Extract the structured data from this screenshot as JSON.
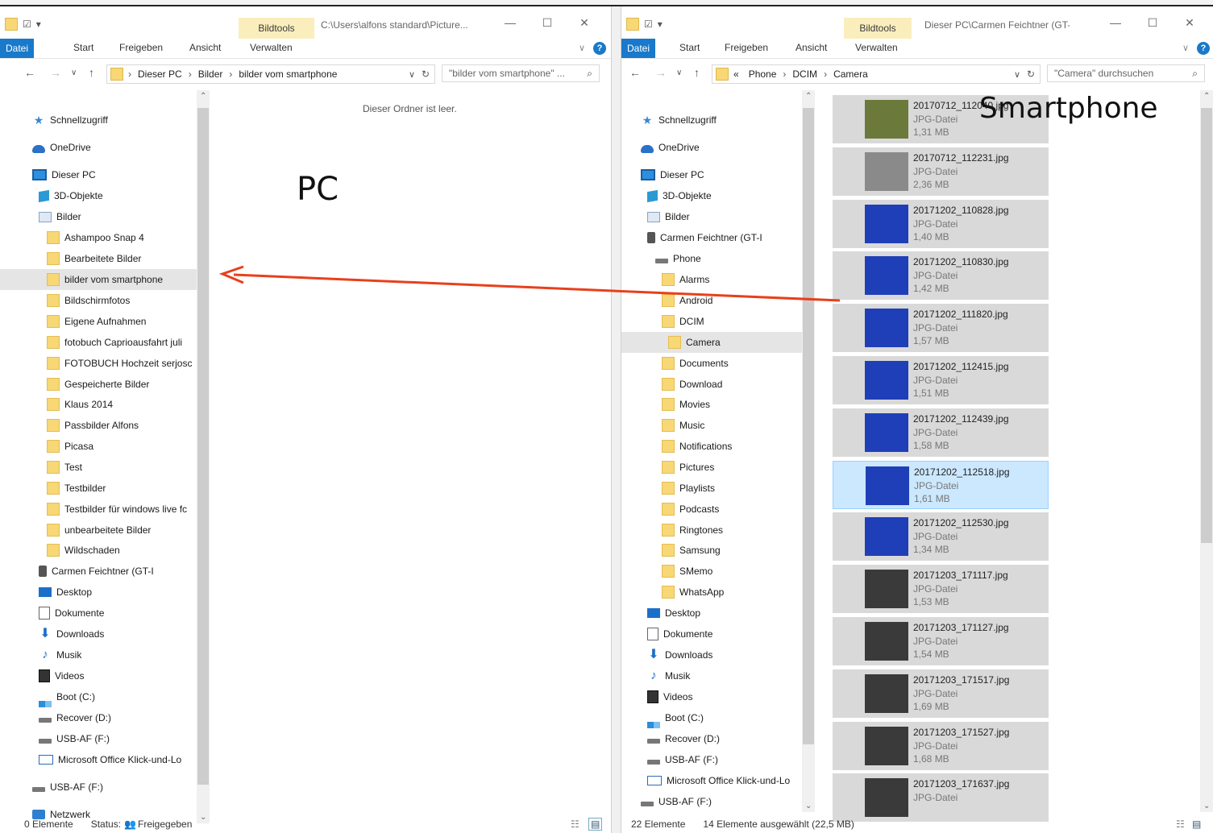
{
  "left_window": {
    "path_title": "C:\\Users\\alfons standard\\Picture...",
    "context_tab": "Bildtools",
    "ribbon_tabs": [
      "Datei",
      "Start",
      "Freigeben",
      "Ansicht",
      "Verwalten"
    ],
    "breadcrumb": [
      "Dieser PC",
      "Bilder",
      "bilder vom smartphone"
    ],
    "search_placeholder": "\"bilder vom smartphone\" ...",
    "empty_message": "Dieser Ordner ist leer.",
    "overlay_label": "PC",
    "nav": [
      {
        "label": "Schnellzugriff",
        "icon": "star-icon"
      },
      {
        "label": "OneDrive",
        "icon": "cloud-icon"
      },
      {
        "label": "Dieser PC",
        "icon": "pc-icon"
      },
      {
        "label": "3D-Objekte",
        "icon": "cube-icon"
      },
      {
        "label": "Bilder",
        "icon": "pictures-icon"
      },
      {
        "label": "Ashampoo Snap 4",
        "icon": "folder-icon"
      },
      {
        "label": "Bearbeitete Bilder",
        "icon": "folder-icon"
      },
      {
        "label": "bilder vom smartphone",
        "icon": "folder-icon",
        "selected": true
      },
      {
        "label": "Bildschirmfotos",
        "icon": "folder-icon"
      },
      {
        "label": "Eigene Aufnahmen",
        "icon": "folder-icon"
      },
      {
        "label": "fotobuch Caprioausfahrt juli",
        "icon": "folder-icon"
      },
      {
        "label": "FOTOBUCH Hochzeit serjosc",
        "icon": "folder-icon"
      },
      {
        "label": "Gespeicherte Bilder",
        "icon": "folder-icon"
      },
      {
        "label": "Klaus 2014",
        "icon": "folder-icon"
      },
      {
        "label": "Passbilder Alfons",
        "icon": "folder-icon"
      },
      {
        "label": "Picasa",
        "icon": "folder-icon"
      },
      {
        "label": "Test",
        "icon": "folder-icon"
      },
      {
        "label": "Testbilder",
        "icon": "folder-icon"
      },
      {
        "label": "Testbilder für windows live fc",
        "icon": "folder-icon"
      },
      {
        "label": "unbearbeitete Bilder",
        "icon": "folder-icon"
      },
      {
        "label": "Wildschaden",
        "icon": "folder-icon"
      },
      {
        "label": "Carmen Feichtner (GT-I",
        "icon": "phone-icon"
      },
      {
        "label": "Desktop",
        "icon": "desktop-icon"
      },
      {
        "label": "Dokumente",
        "icon": "document-icon"
      },
      {
        "label": "Downloads",
        "icon": "download-icon"
      },
      {
        "label": "Musik",
        "icon": "music-icon"
      },
      {
        "label": "Videos",
        "icon": "video-icon"
      },
      {
        "label": "Boot (C:)",
        "icon": "windows-drive-icon"
      },
      {
        "label": "Recover (D:)",
        "icon": "drive-icon"
      },
      {
        "label": "USB-AF (F:)",
        "icon": "drive-icon"
      },
      {
        "label": "Microsoft Office Klick-und-Lo",
        "icon": "office-icon"
      },
      {
        "label": "USB-AF (F:)",
        "icon": "drive-icon"
      },
      {
        "label": "Netzwerk",
        "icon": "network-icon"
      }
    ],
    "status_count": "0 Elemente",
    "status_share": "Status:",
    "status_share_value": "Freigegeben"
  },
  "right_window": {
    "path_title": "Dieser PC\\Carmen Feichtner (GT-...",
    "context_tab": "Bildtools",
    "ribbon_tabs": [
      "Datei",
      "Start",
      "Freigeben",
      "Ansicht",
      "Verwalten"
    ],
    "breadcrumb": [
      "«",
      "Phone",
      "DCIM",
      "Camera"
    ],
    "search_placeholder": "\"Camera\" durchsuchen",
    "overlay_label": "Smartphone",
    "nav": [
      {
        "label": "Schnellzugriff",
        "icon": "star-icon"
      },
      {
        "label": "OneDrive",
        "icon": "cloud-icon"
      },
      {
        "label": "Dieser PC",
        "icon": "pc-icon"
      },
      {
        "label": "3D-Objekte",
        "icon": "cube-icon"
      },
      {
        "label": "Bilder",
        "icon": "pictures-icon"
      },
      {
        "label": "Carmen Feichtner (GT-I",
        "icon": "phone-icon"
      },
      {
        "label": "Phone",
        "icon": "drive-icon"
      },
      {
        "label": "Alarms",
        "icon": "folder-icon"
      },
      {
        "label": "Android",
        "icon": "folder-icon"
      },
      {
        "label": "DCIM",
        "icon": "folder-icon"
      },
      {
        "label": "Camera",
        "icon": "folder-icon",
        "selected": true
      },
      {
        "label": "Documents",
        "icon": "folder-icon"
      },
      {
        "label": "Download",
        "icon": "folder-icon"
      },
      {
        "label": "Movies",
        "icon": "folder-icon"
      },
      {
        "label": "Music",
        "icon": "folder-icon"
      },
      {
        "label": "Notifications",
        "icon": "folder-icon"
      },
      {
        "label": "Pictures",
        "icon": "folder-icon"
      },
      {
        "label": "Playlists",
        "icon": "folder-icon"
      },
      {
        "label": "Podcasts",
        "icon": "folder-icon"
      },
      {
        "label": "Ringtones",
        "icon": "folder-icon"
      },
      {
        "label": "Samsung",
        "icon": "folder-icon"
      },
      {
        "label": "SMemo",
        "icon": "folder-icon"
      },
      {
        "label": "WhatsApp",
        "icon": "folder-icon"
      },
      {
        "label": "Desktop",
        "icon": "desktop-icon"
      },
      {
        "label": "Dokumente",
        "icon": "document-icon"
      },
      {
        "label": "Downloads",
        "icon": "download-icon"
      },
      {
        "label": "Musik",
        "icon": "music-icon"
      },
      {
        "label": "Videos",
        "icon": "video-icon"
      },
      {
        "label": "Boot (C:)",
        "icon": "windows-drive-icon"
      },
      {
        "label": "Recover (D:)",
        "icon": "drive-icon"
      },
      {
        "label": "USB-AF (F:)",
        "icon": "drive-icon"
      },
      {
        "label": "Microsoft Office Klick-und-Lo",
        "icon": "office-icon"
      },
      {
        "label": "USB-AF (F:)",
        "icon": "drive-icon"
      }
    ],
    "files": [
      {
        "name": "20170712_112040.jpg",
        "type": "JPG-Datei",
        "size": "1,31 MB"
      },
      {
        "name": "20170712_112231.jpg",
        "type": "JPG-Datei",
        "size": "2,36 MB"
      },
      {
        "name": "20171202_110828.jpg",
        "type": "JPG-Datei",
        "size": "1,40 MB"
      },
      {
        "name": "20171202_110830.jpg",
        "type": "JPG-Datei",
        "size": "1,42 MB"
      },
      {
        "name": "20171202_111820.jpg",
        "type": "JPG-Datei",
        "size": "1,57 MB"
      },
      {
        "name": "20171202_112415.jpg",
        "type": "JPG-Datei",
        "size": "1,51 MB"
      },
      {
        "name": "20171202_112439.jpg",
        "type": "JPG-Datei",
        "size": "1,58 MB"
      },
      {
        "name": "20171202_112518.jpg",
        "type": "JPG-Datei",
        "size": "1,61 MB",
        "focused": true
      },
      {
        "name": "20171202_112530.jpg",
        "type": "JPG-Datei",
        "size": "1,34 MB"
      },
      {
        "name": "20171203_171117.jpg",
        "type": "JPG-Datei",
        "size": "1,53 MB"
      },
      {
        "name": "20171203_171127.jpg",
        "type": "JPG-Datei",
        "size": "1,54 MB"
      },
      {
        "name": "20171203_171517.jpg",
        "type": "JPG-Datei",
        "size": "1,69 MB"
      },
      {
        "name": "20171203_171527.jpg",
        "type": "JPG-Datei",
        "size": "1,68 MB"
      },
      {
        "name": "20171203_171637.jpg",
        "type": "JPG-Datei",
        "size": ""
      }
    ],
    "status_count": "22 Elemente",
    "status_selected": "14 Elemente ausgewählt (22,5 MB)"
  },
  "colors": {
    "accent": "#1979ca",
    "arrow": "#e8401c",
    "selection": "#cce8ff"
  }
}
